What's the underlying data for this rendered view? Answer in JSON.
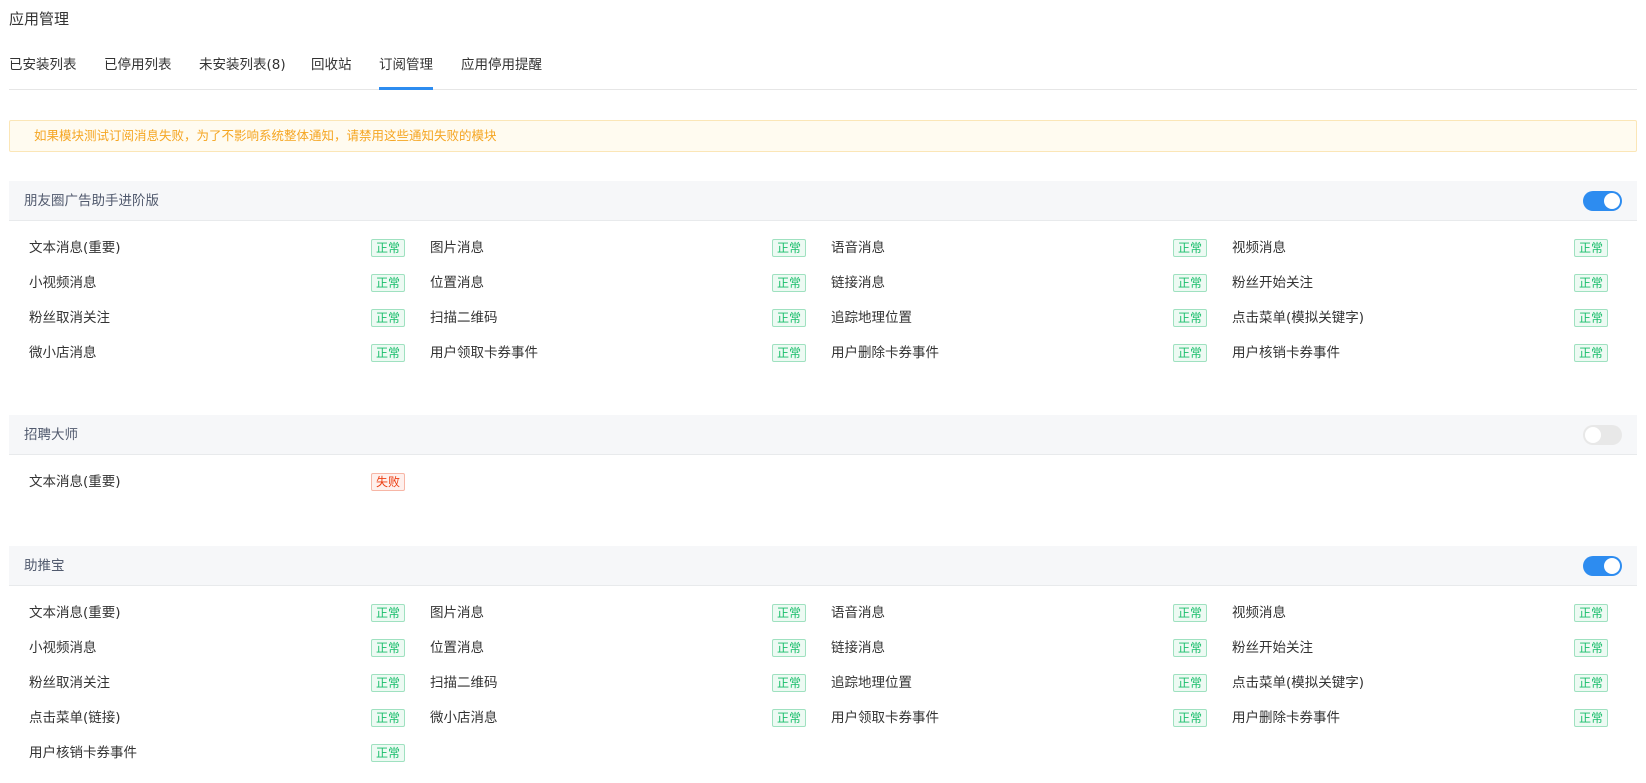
{
  "page_title": "应用管理",
  "tabs": [
    {
      "label": "已安装列表",
      "active": false
    },
    {
      "label": "已停用列表",
      "active": false
    },
    {
      "label": "未安装列表(8)",
      "active": false
    },
    {
      "label": "回收站",
      "active": false
    },
    {
      "label": "订阅管理",
      "active": true
    },
    {
      "label": "应用停用提醒",
      "active": false
    }
  ],
  "alert_text": "如果模块测试订阅消息失败，为了不影响系统整体通知，请禁用这些通知失败的模块",
  "status_labels": {
    "ok": "正常",
    "fail": "失败"
  },
  "colors": {
    "accent": "#2d8cf0",
    "ok": "#19be6b",
    "fail": "#ed3f14",
    "warn": "#f5a623"
  },
  "sections": [
    {
      "title": "朋友圈广告助手进阶版",
      "enabled": true,
      "items": [
        {
          "name": "文本消息(重要)",
          "status": "正常"
        },
        {
          "name": "图片消息",
          "status": "正常"
        },
        {
          "name": "语音消息",
          "status": "正常"
        },
        {
          "name": "视频消息",
          "status": "正常"
        },
        {
          "name": "小视频消息",
          "status": "正常"
        },
        {
          "name": "位置消息",
          "status": "正常"
        },
        {
          "name": "链接消息",
          "status": "正常"
        },
        {
          "name": "粉丝开始关注",
          "status": "正常"
        },
        {
          "name": "粉丝取消关注",
          "status": "正常"
        },
        {
          "name": "扫描二维码",
          "status": "正常"
        },
        {
          "name": "追踪地理位置",
          "status": "正常"
        },
        {
          "name": "点击菜单(模拟关键字)",
          "status": "正常"
        },
        {
          "name": "微小店消息",
          "status": "正常"
        },
        {
          "name": "用户领取卡券事件",
          "status": "正常"
        },
        {
          "name": "用户删除卡券事件",
          "status": "正常"
        },
        {
          "name": "用户核销卡券事件",
          "status": "正常"
        }
      ]
    },
    {
      "title": "招聘大师",
      "enabled": false,
      "items": [
        {
          "name": "文本消息(重要)",
          "status": "失败"
        }
      ]
    },
    {
      "title": "助推宝",
      "enabled": true,
      "items": [
        {
          "name": "文本消息(重要)",
          "status": "正常"
        },
        {
          "name": "图片消息",
          "status": "正常"
        },
        {
          "name": "语音消息",
          "status": "正常"
        },
        {
          "name": "视频消息",
          "status": "正常"
        },
        {
          "name": "小视频消息",
          "status": "正常"
        },
        {
          "name": "位置消息",
          "status": "正常"
        },
        {
          "name": "链接消息",
          "status": "正常"
        },
        {
          "name": "粉丝开始关注",
          "status": "正常"
        },
        {
          "name": "粉丝取消关注",
          "status": "正常"
        },
        {
          "name": "扫描二维码",
          "status": "正常"
        },
        {
          "name": "追踪地理位置",
          "status": "正常"
        },
        {
          "name": "点击菜单(模拟关键字)",
          "status": "正常"
        },
        {
          "name": "点击菜单(链接)",
          "status": "正常"
        },
        {
          "name": "微小店消息",
          "status": "正常"
        },
        {
          "name": "用户领取卡券事件",
          "status": "正常"
        },
        {
          "name": "用户删除卡券事件",
          "status": "正常"
        },
        {
          "name": "用户核销卡券事件",
          "status": "正常"
        }
      ]
    }
  ]
}
